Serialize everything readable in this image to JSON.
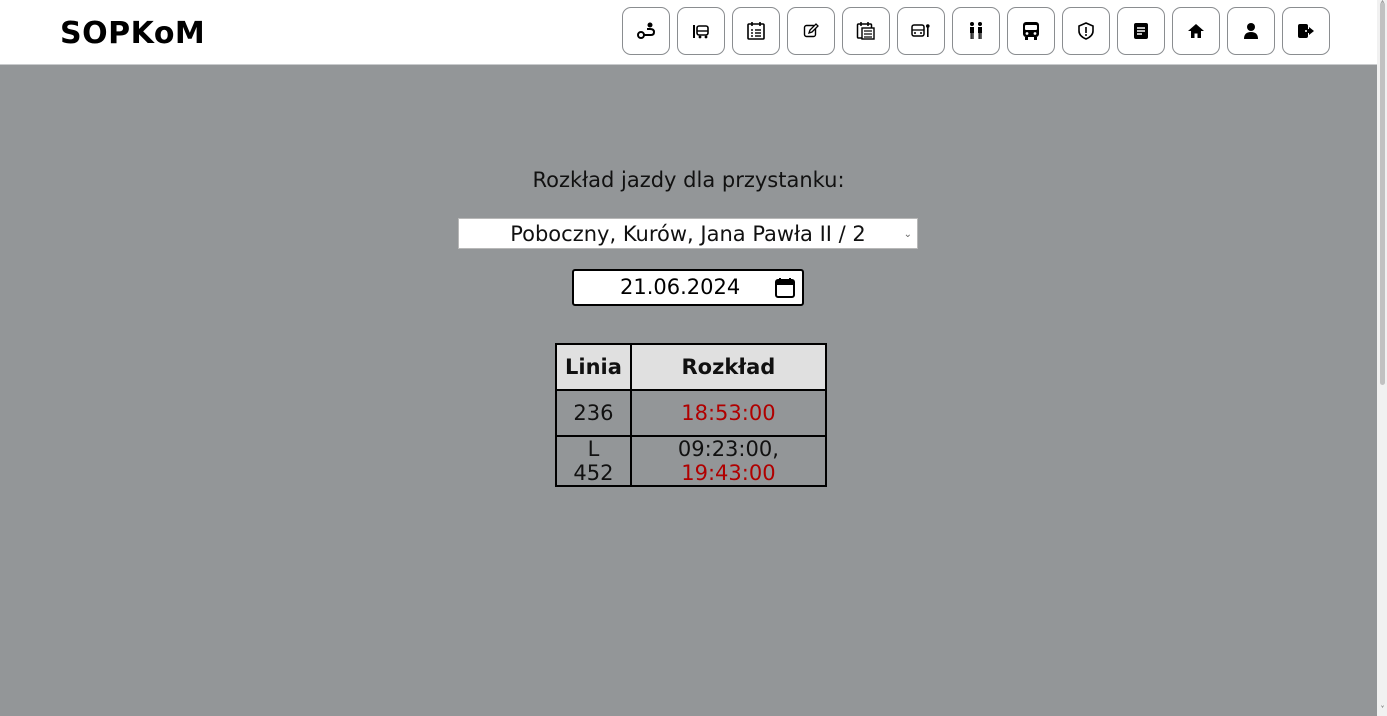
{
  "header": {
    "logo": "SOPKoM",
    "nav": [
      {
        "icon": "route-icon"
      },
      {
        "icon": "bus-stop-icon"
      },
      {
        "icon": "calendar-list-icon"
      },
      {
        "icon": "edit-icon"
      },
      {
        "icon": "schedule-icon"
      },
      {
        "icon": "depot-icon"
      },
      {
        "icon": "people-icon"
      },
      {
        "icon": "bus-icon"
      },
      {
        "icon": "shield-icon"
      },
      {
        "icon": "document-icon"
      },
      {
        "icon": "home-icon"
      },
      {
        "icon": "user-icon"
      },
      {
        "icon": "logout-icon"
      }
    ]
  },
  "main": {
    "heading": "Rozkład jazdy dla przystanku:",
    "stop_select": {
      "value": "Poboczny, Kurów, Jana Pawła II / 2"
    },
    "date_input": {
      "value": "21.06.2024"
    },
    "table": {
      "headers": [
        "Linia",
        "Rozkład"
      ],
      "rows": [
        {
          "line": "236",
          "departures": [
            {
              "time": "18:53:00",
              "status": "upcoming"
            }
          ]
        },
        {
          "line": "L 452",
          "departures": [
            {
              "time": "09:23:00",
              "status": "past"
            },
            {
              "time": "19:43:00",
              "status": "upcoming"
            }
          ]
        }
      ]
    }
  },
  "colors": {
    "background": "#939698",
    "upcoming": "#b00000",
    "header_cell": "#e0e0e0"
  }
}
